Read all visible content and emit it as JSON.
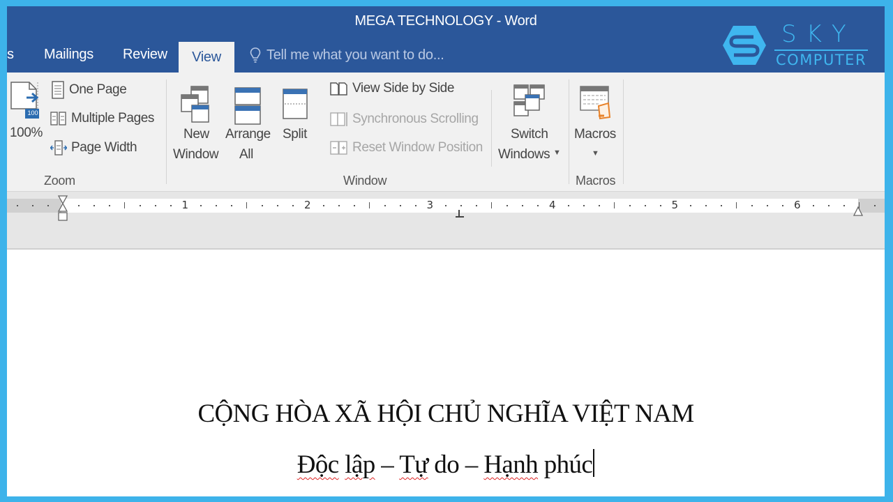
{
  "window": {
    "title": "MEGA TECHNOLOGY - Word"
  },
  "tabs": [
    {
      "label": "s",
      "active": false
    },
    {
      "label": "Mailings",
      "active": false
    },
    {
      "label": "Review",
      "active": false
    },
    {
      "label": "View",
      "active": true
    }
  ],
  "tell_me": {
    "placeholder": "Tell me what you want to do...",
    "icon": "lightbulb-icon"
  },
  "logo": {
    "top": "SKY",
    "bottom": "COMPUTER",
    "color": "#3fb6ef"
  },
  "ribbon": {
    "zoom_group": {
      "label": "Zoom",
      "zoom100": {
        "label": "100%",
        "badge": "100"
      },
      "one_page": "One Page",
      "multiple_pages": "Multiple Pages",
      "page_width": "Page Width"
    },
    "window_group": {
      "label": "Window",
      "new_window": [
        "New",
        "Window"
      ],
      "arrange_all": [
        "Arrange",
        "All"
      ],
      "split": "Split",
      "view_side_by_side": "View Side by Side",
      "synchronous_scrolling": "Synchronous Scrolling",
      "reset_window_position": "Reset Window Position",
      "switch_windows": [
        "Switch",
        "Windows"
      ]
    },
    "macros_group": {
      "label": "Macros",
      "macros": "Macros"
    }
  },
  "ruler": {
    "numbers": [
      "1",
      "2",
      "3",
      "4",
      "5",
      "6"
    ]
  },
  "document": {
    "line1": "CỘNG HÒA XÃ HỘI CHỦ NGHĨA VIỆT NAM",
    "line2": {
      "w1": "Độc",
      "w2": "lập",
      "sep1": " – ",
      "w3": "Tự",
      "w4": " do – ",
      "w5": "Hạnh",
      "w6": " phúc"
    }
  },
  "colors": {
    "frame": "#3db3ea",
    "titlebar": "#2b579a",
    "ribbon": "#f1f1f1",
    "accent_orange": "#e8822a"
  }
}
